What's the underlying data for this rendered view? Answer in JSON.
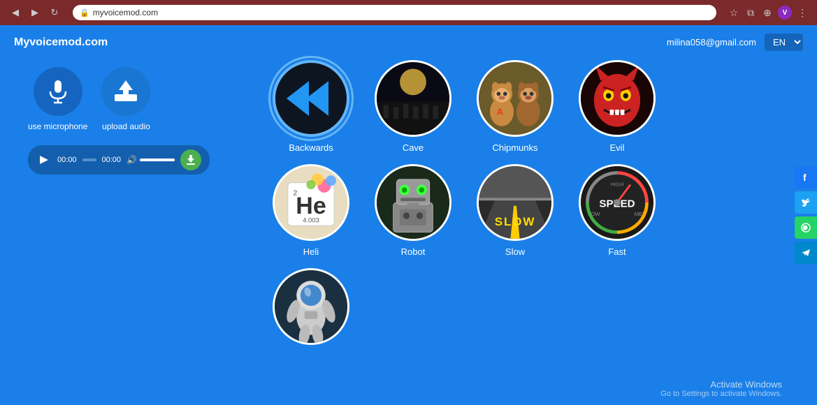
{
  "browser": {
    "url": "myvoicemod.com",
    "nav_back": "◀",
    "nav_forward": "▶",
    "nav_refresh": "↻",
    "ext_label": "V"
  },
  "header": {
    "logo": "Myvoicemod.com",
    "user_email": "milina058@gmail.com",
    "lang": "EN"
  },
  "left_panel": {
    "mic_label": "use microphone",
    "upload_label": "upload audio",
    "time_start": "00:00",
    "time_end": "00:00"
  },
  "voices": {
    "row1": [
      {
        "id": "backwards",
        "label": "Backwards",
        "selected": true
      },
      {
        "id": "cave",
        "label": "Cave",
        "selected": false
      },
      {
        "id": "chipmunks",
        "label": "Chipmunks",
        "selected": false
      },
      {
        "id": "evil",
        "label": "Evil",
        "selected": false
      }
    ],
    "row2": [
      {
        "id": "heli",
        "label": "Heli",
        "selected": false
      },
      {
        "id": "robot",
        "label": "Robot",
        "selected": false
      },
      {
        "id": "slow",
        "label": "Slow",
        "selected": false
      },
      {
        "id": "fast",
        "label": "Fast",
        "selected": false
      }
    ],
    "row3": [
      {
        "id": "last",
        "label": "",
        "selected": false
      }
    ]
  },
  "activate": {
    "title": "Activate Windows",
    "subtitle": "Go to Settings to activate Windows."
  },
  "social": {
    "fb": "f",
    "tw": "t",
    "wa": "w",
    "tg": "➤"
  }
}
